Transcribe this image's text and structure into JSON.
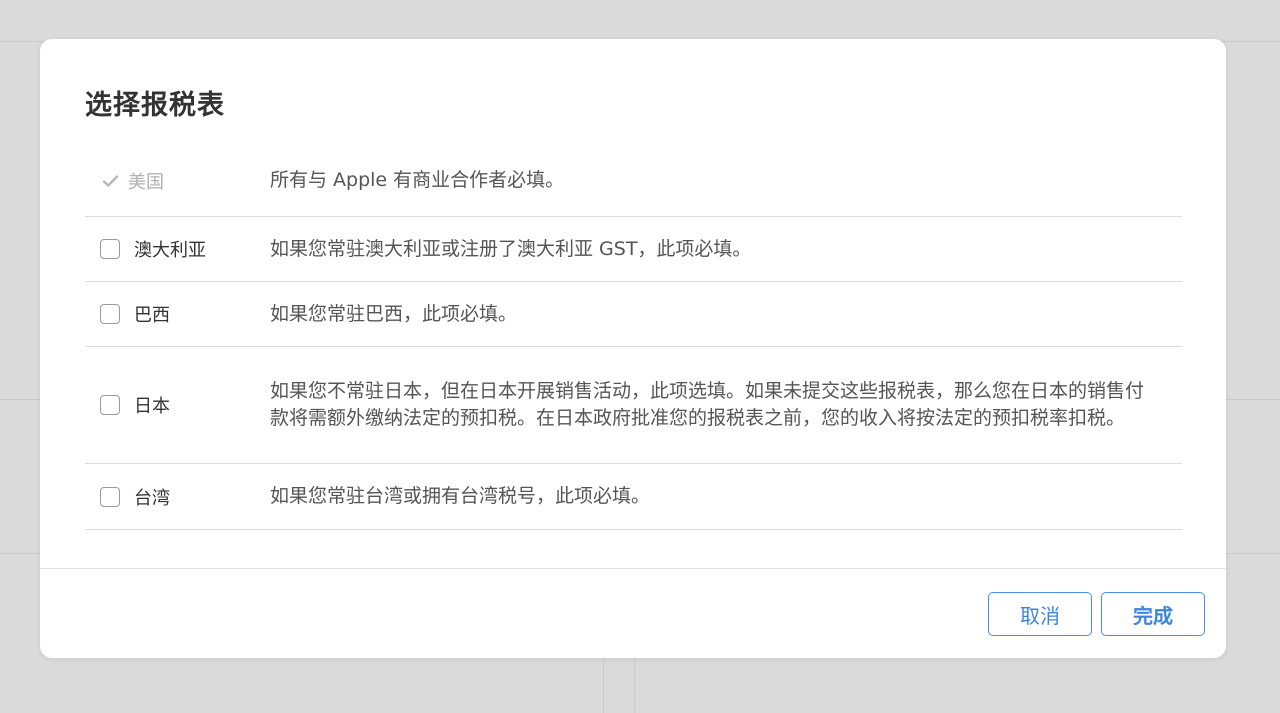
{
  "dialog": {
    "title": "选择报税表",
    "rows": [
      {
        "country": "美国",
        "description": "所有与 Apple 有商业合作者必填。",
        "checked": true,
        "disabled": true
      },
      {
        "country": "澳大利亚",
        "description": "如果您常驻澳大利亚或注册了澳大利亚 GST，此项必填。",
        "checked": false,
        "disabled": false
      },
      {
        "country": "巴西",
        "description": "如果您常驻巴西，此项必填。",
        "checked": false,
        "disabled": false
      },
      {
        "country": "日本",
        "description": "如果您不常驻日本，但在日本开展销售活动，此项选填。如果未提交这些报税表，那么您在日本的销售付款将需额外缴纳法定的预扣税。在日本政府批准您的报税表之前，您的收入将按法定的预扣税率扣税。",
        "checked": false,
        "disabled": false
      },
      {
        "country": "台湾",
        "description": "如果您常驻台湾或拥有台湾税号，此项必填。",
        "checked": false,
        "disabled": false
      }
    ],
    "buttons": {
      "cancel_label": "取消",
      "done_label": "完成"
    }
  },
  "colors": {
    "accent": "#3b86dd",
    "disabled_text": "#b0b0b0",
    "checkmark": "#b8b8b8"
  }
}
